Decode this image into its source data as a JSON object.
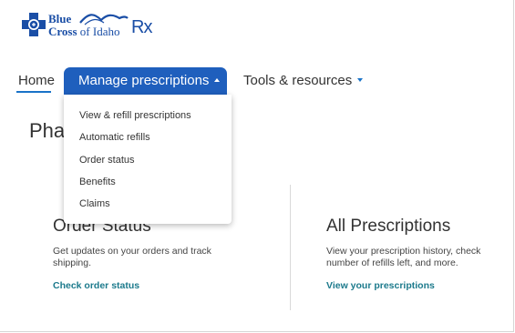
{
  "brand": {
    "line1": "Blue",
    "line2_bold": "Cross",
    "line2_rest": " of Idaho",
    "rx": "Rx",
    "color": "#1a4ea6"
  },
  "nav": {
    "home": "Home",
    "manage": "Manage prescriptions",
    "tools": "Tools & resources",
    "active_color": "#1f5fbd",
    "underline_color": "#1a73c8"
  },
  "dropdown": {
    "items": [
      "View & refill prescriptions",
      "Automatic refills",
      "Order status",
      "Benefits",
      "Claims"
    ]
  },
  "page": {
    "title": "Pharmacy"
  },
  "cards": {
    "order": {
      "heading": "Order Status",
      "desc": "Get updates on your orders and track shipping.",
      "link": "Check order status"
    },
    "prescriptions": {
      "heading": "All Prescriptions",
      "desc": "View your prescription history, check number of refills left, and more.",
      "link": "View your prescriptions"
    },
    "link_color": "#1c7a8c"
  },
  "icons": {
    "logo_mark": "cross-shield-icon",
    "logo_wave": "mountain-wave-icon",
    "manage_caret": "caret-up-icon",
    "tools_caret": "caret-down-icon"
  }
}
